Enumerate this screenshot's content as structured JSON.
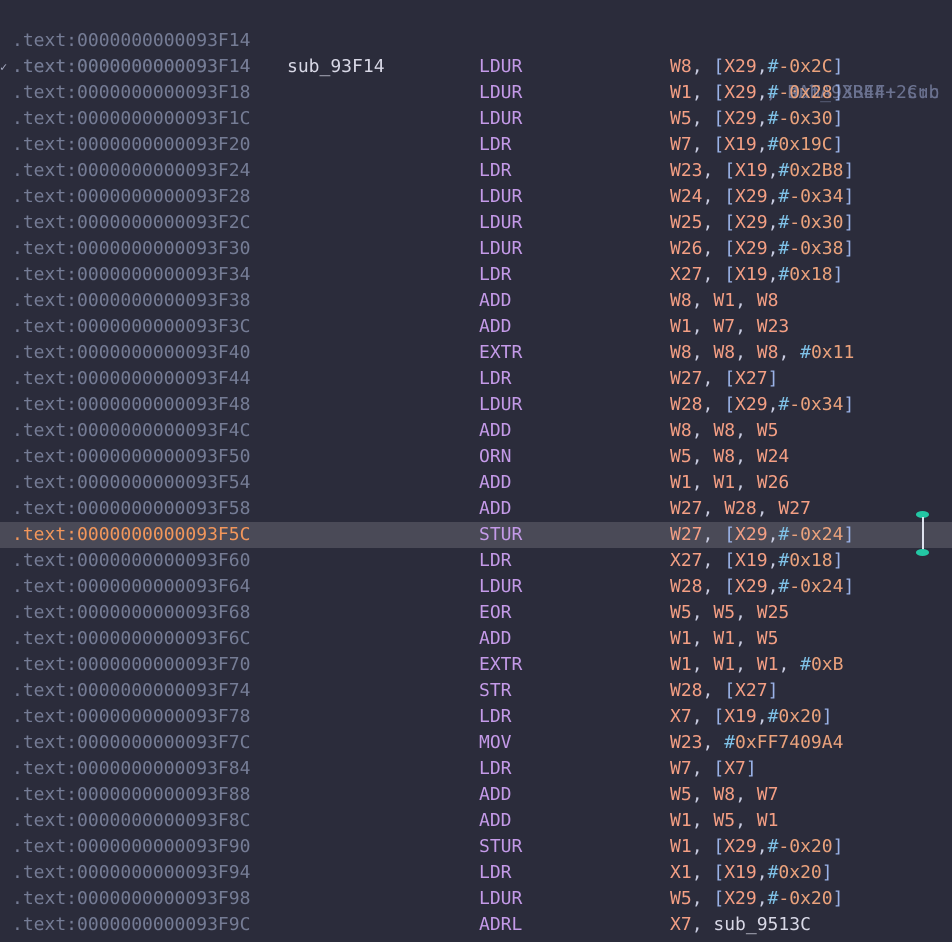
{
  "header_lines": [
    {
      "address": ".text:0000000000093F14",
      "label": "sub_93F14",
      "comment": "; DATA XREF: sub"
    },
    {
      "address": ".text:0000000000093F14",
      "label": "",
      "comment": "; sub_93B44+2C↑c"
    }
  ],
  "selected_address": ".text:0000000000093F5C",
  "instructions": [
    {
      "address": ".text:0000000000093F14",
      "mnemonic": "LDUR",
      "operands": "W8, [X29,#-0x2C]"
    },
    {
      "address": ".text:0000000000093F18",
      "mnemonic": "LDUR",
      "operands": "W1, [X29,#-0x28]"
    },
    {
      "address": ".text:0000000000093F1C",
      "mnemonic": "LDUR",
      "operands": "W5, [X29,#-0x30]"
    },
    {
      "address": ".text:0000000000093F20",
      "mnemonic": "LDR",
      "operands": "W7, [X19,#0x19C]"
    },
    {
      "address": ".text:0000000000093F24",
      "mnemonic": "LDR",
      "operands": "W23, [X19,#0x2B8]"
    },
    {
      "address": ".text:0000000000093F28",
      "mnemonic": "LDUR",
      "operands": "W24, [X29,#-0x34]"
    },
    {
      "address": ".text:0000000000093F2C",
      "mnemonic": "LDUR",
      "operands": "W25, [X29,#-0x30]"
    },
    {
      "address": ".text:0000000000093F30",
      "mnemonic": "LDUR",
      "operands": "W26, [X29,#-0x38]"
    },
    {
      "address": ".text:0000000000093F34",
      "mnemonic": "LDR",
      "operands": "X27, [X19,#0x18]"
    },
    {
      "address": ".text:0000000000093F38",
      "mnemonic": "ADD",
      "operands": "W8, W1, W8"
    },
    {
      "address": ".text:0000000000093F3C",
      "mnemonic": "ADD",
      "operands": "W1, W7, W23"
    },
    {
      "address": ".text:0000000000093F40",
      "mnemonic": "EXTR",
      "operands": "W8, W8, W8, #0x11"
    },
    {
      "address": ".text:0000000000093F44",
      "mnemonic": "LDR",
      "operands": "W27, [X27]"
    },
    {
      "address": ".text:0000000000093F48",
      "mnemonic": "LDUR",
      "operands": "W28, [X29,#-0x34]"
    },
    {
      "address": ".text:0000000000093F4C",
      "mnemonic": "ADD",
      "operands": "W8, W8, W5"
    },
    {
      "address": ".text:0000000000093F50",
      "mnemonic": "ORN",
      "operands": "W5, W8, W24"
    },
    {
      "address": ".text:0000000000093F54",
      "mnemonic": "ADD",
      "operands": "W1, W1, W26"
    },
    {
      "address": ".text:0000000000093F58",
      "mnemonic": "ADD",
      "operands": "W27, W28, W27"
    },
    {
      "address": ".text:0000000000093F5C",
      "mnemonic": "STUR",
      "operands": "W27, [X29,#-0x24]"
    },
    {
      "address": ".text:0000000000093F60",
      "mnemonic": "LDR",
      "operands": "X27, [X19,#0x18]"
    },
    {
      "address": ".text:0000000000093F64",
      "mnemonic": "LDUR",
      "operands": "W28, [X29,#-0x24]"
    },
    {
      "address": ".text:0000000000093F68",
      "mnemonic": "EOR",
      "operands": "W5, W5, W25"
    },
    {
      "address": ".text:0000000000093F6C",
      "mnemonic": "ADD",
      "operands": "W1, W1, W5"
    },
    {
      "address": ".text:0000000000093F70",
      "mnemonic": "EXTR",
      "operands": "W1, W1, W1, #0xB"
    },
    {
      "address": ".text:0000000000093F74",
      "mnemonic": "STR",
      "operands": "W28, [X27]"
    },
    {
      "address": ".text:0000000000093F78",
      "mnemonic": "LDR",
      "operands": "X7, [X19,#0x20]"
    },
    {
      "address": ".text:0000000000093F7C",
      "mnemonic": "MOV",
      "operands": "W23, #0xFF7409A4"
    },
    {
      "address": ".text:0000000000093F84",
      "mnemonic": "LDR",
      "operands": "W7, [X7]"
    },
    {
      "address": ".text:0000000000093F88",
      "mnemonic": "ADD",
      "operands": "W5, W8, W7"
    },
    {
      "address": ".text:0000000000093F8C",
      "mnemonic": "ADD",
      "operands": "W1, W5, W1"
    },
    {
      "address": ".text:0000000000093F90",
      "mnemonic": "STUR",
      "operands": "W1, [X29,#-0x20]"
    },
    {
      "address": ".text:0000000000093F94",
      "mnemonic": "LDR",
      "operands": "X1, [X19,#0x20]"
    },
    {
      "address": ".text:0000000000093F98",
      "mnemonic": "LDUR",
      "operands": "W5, [X29,#-0x20]"
    },
    {
      "address": ".text:0000000000093F9C",
      "mnemonic": "ADRL",
      "operands": "X7, sub_9513C"
    }
  ],
  "colors": {
    "background": "#2b2c3b",
    "highlight_row": "#4a4a57",
    "address": "#757c95",
    "selected_address": "#f2965b",
    "mnemonic": "#c49ae8",
    "register": "#f49f84",
    "immediate": "#eaa27c",
    "bracket": "#9bb3e8",
    "comment": "#6b7290",
    "cursor_handle": "#23c7a4"
  },
  "icons": {
    "gutter_mark": "checkmark-glyph",
    "text_cursor": "i-beam-cursor-icon"
  }
}
